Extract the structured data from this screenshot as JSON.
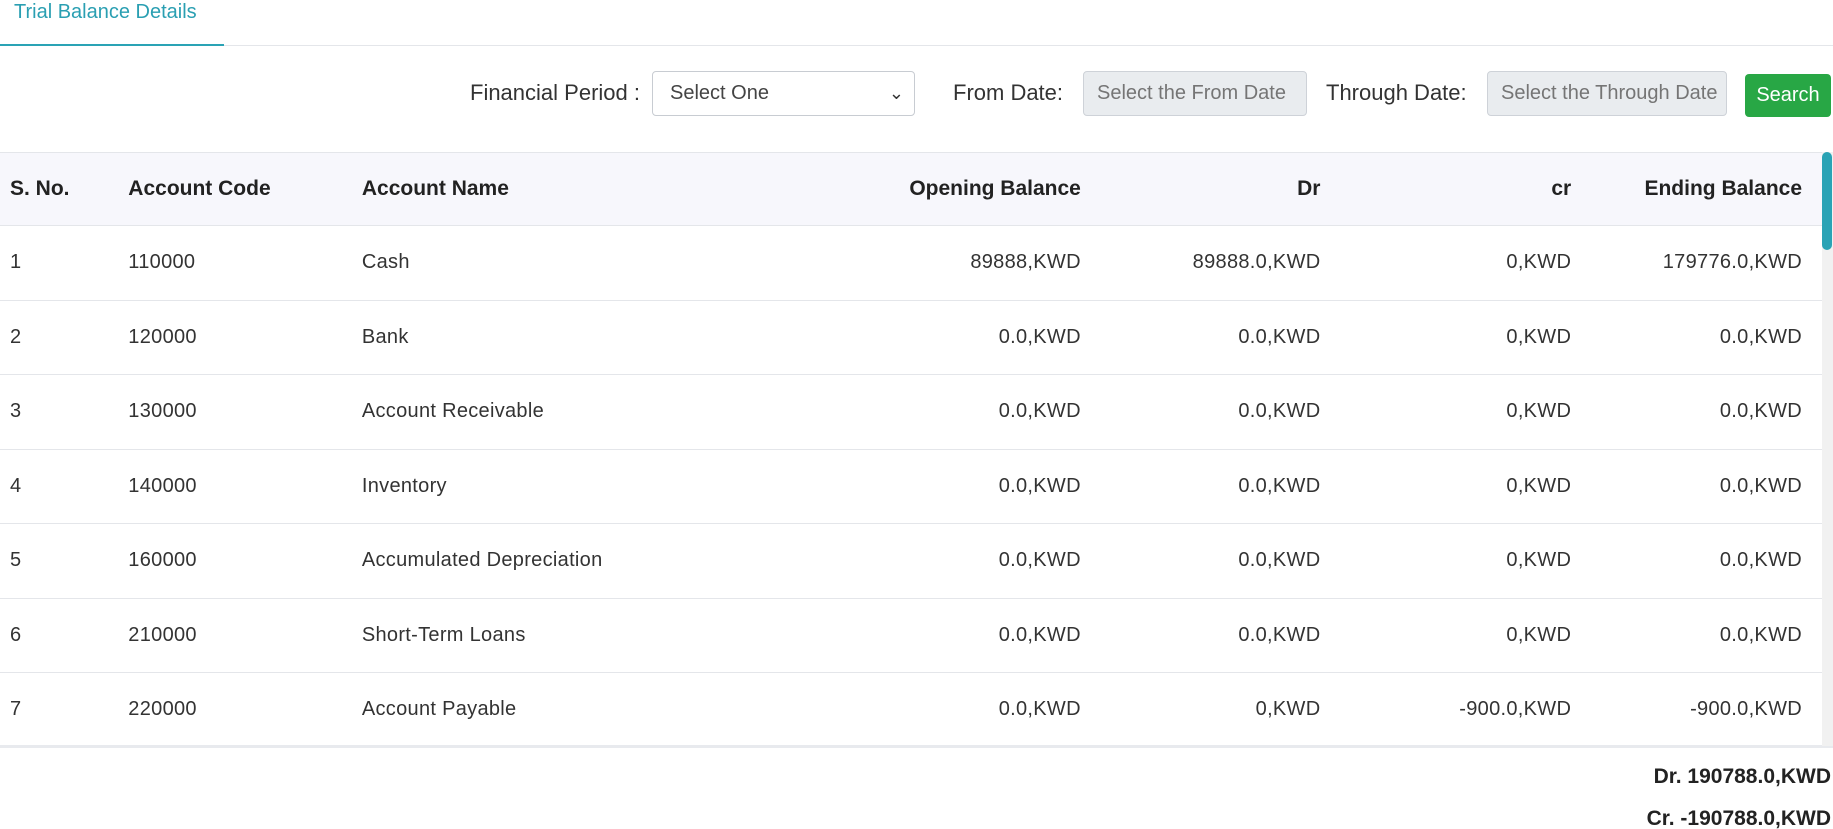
{
  "tab": {
    "label": "Trial Balance Details"
  },
  "filters": {
    "financial_period_label": "Financial Period :",
    "financial_period_value": "Select One",
    "from_date_label": "From Date:",
    "from_date_placeholder": "Select the From Date",
    "through_date_label": "Through Date:",
    "through_date_placeholder": "Select the Through Date",
    "search_label": "Search"
  },
  "table": {
    "headers": [
      "S. No.",
      "Account Code",
      "Account Name",
      "Opening Balance",
      "Dr",
      "cr",
      "Ending Balance"
    ],
    "rows": [
      [
        "1",
        "110000",
        "Cash",
        "89888,KWD",
        "89888.0,KWD",
        "0,KWD",
        "179776.0,KWD"
      ],
      [
        "2",
        "120000",
        "Bank",
        "0.0,KWD",
        "0.0,KWD",
        "0,KWD",
        "0.0,KWD"
      ],
      [
        "3",
        "130000",
        "Account Receivable",
        "0.0,KWD",
        "0.0,KWD",
        "0,KWD",
        "0.0,KWD"
      ],
      [
        "4",
        "140000",
        "Inventory",
        "0.0,KWD",
        "0.0,KWD",
        "0,KWD",
        "0.0,KWD"
      ],
      [
        "5",
        "160000",
        "Accumulated Depreciation",
        "0.0,KWD",
        "0.0,KWD",
        "0,KWD",
        "0.0,KWD"
      ],
      [
        "6",
        "210000",
        "Short-Term Loans",
        "0.0,KWD",
        "0.0,KWD",
        "0,KWD",
        "0.0,KWD"
      ],
      [
        "7",
        "220000",
        "Account Payable",
        "0.0,KWD",
        "0,KWD",
        "-900.0,KWD",
        "-900.0,KWD"
      ]
    ]
  },
  "totals": {
    "dr": "Dr. 190788.0,KWD",
    "cr": "Cr. -190788.0,KWD"
  },
  "colors": {
    "accent": "#2aa3b5",
    "search_button": "#28a745"
  },
  "icons": {
    "select_chevron": "chevron-down-icon"
  }
}
